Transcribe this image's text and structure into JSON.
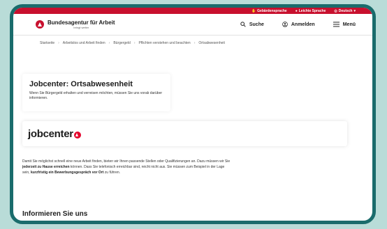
{
  "utility": {
    "sign_language": "Gebärdensprache",
    "easy_language": "Leichte Sprache",
    "language": "Deutsch"
  },
  "header": {
    "org_name": "Bundesagentur für Arbeit",
    "org_tagline": "bringt weiter",
    "search_label": "Suche",
    "login_label": "Anmelden",
    "menu_label": "Menü"
  },
  "breadcrumb": [
    "Startseite",
    "Arbeitslos und Arbeit finden",
    "Bürgergeld",
    "Pflichten verstehen und beachten",
    "Ortsabwesenheit"
  ],
  "intro": {
    "title": "Jobcenter: Ortsabwesenheit",
    "text": "Wenn Sie Bürgergeld erhalten und verreisen möchten, müssen Sie uns vorab darüber informieren."
  },
  "brand": {
    "wordmark": "jobcenter"
  },
  "body": {
    "p1": "Damit Sie möglichst schnell eine neue Arbeit finden, bieten wir Ihnen passende Stellen oder Qualifizierungen an. Dazu müssen wir Sie ",
    "b1": "jederzeit zu Hause erreichen",
    "p2": " können. Dass Sie telefonisch erreichbar sind, reicht nicht aus. Sie müssen zum Beispiel in der Lage sein, ",
    "b2": "kurzfristig ein Bewerbungsgespräch vor Ort",
    "p3": " zu führen."
  },
  "section": {
    "heading": "Informieren Sie uns"
  },
  "colors": {
    "brand_red": "#c8102e",
    "frame": "#1a6c6c"
  }
}
